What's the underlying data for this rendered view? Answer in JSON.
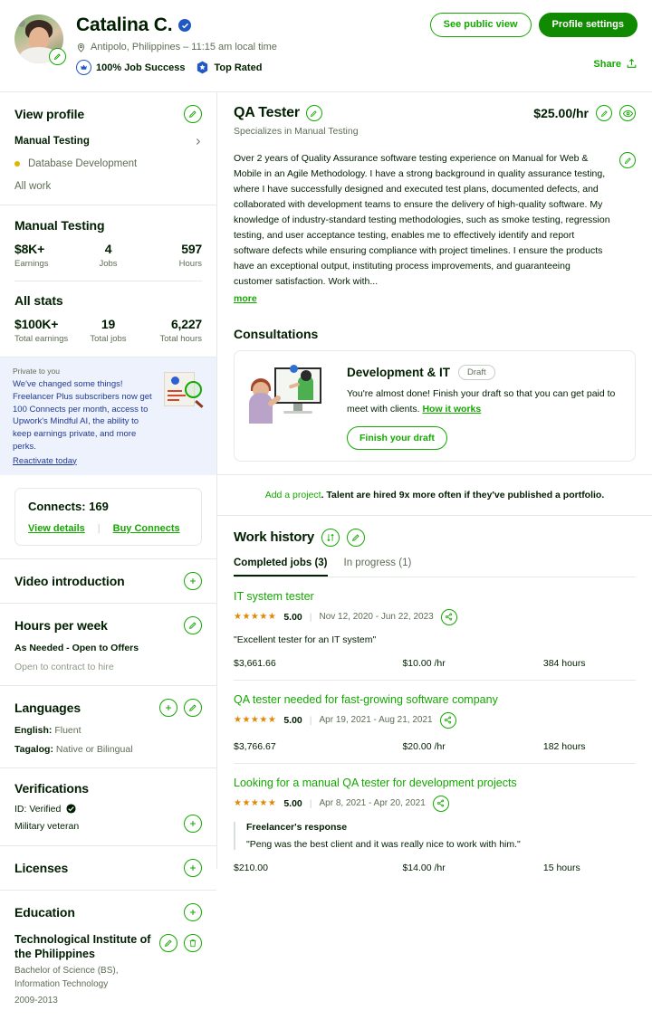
{
  "header": {
    "name": "Catalina C.",
    "verified_icon": "verified-check-icon",
    "location": "Antipolo, Philippines – 11:15 am local time",
    "job_success": "100% Job Success",
    "top_rated": "Top Rated",
    "see_public_view": "See public view",
    "profile_settings": "Profile settings",
    "share": "Share"
  },
  "sidebar": {
    "view_profile": "View profile",
    "nav": {
      "manual_testing": "Manual Testing",
      "database_development": "Database Development",
      "all_work": "All work"
    },
    "specialty_stats": {
      "title": "Manual Testing",
      "items": [
        {
          "value": "$8K+",
          "label": "Earnings"
        },
        {
          "value": "4",
          "label": "Jobs"
        },
        {
          "value": "597",
          "label": "Hours"
        }
      ]
    },
    "all_stats": {
      "title": "All stats",
      "items": [
        {
          "value": "$100K+",
          "label": "Total earnings"
        },
        {
          "value": "19",
          "label": "Total jobs"
        },
        {
          "value": "6,227",
          "label": "Total hours"
        }
      ]
    },
    "promo": {
      "eyebrow": "Private to you",
      "text": "We've changed some things! Freelancer Plus subscribers now get 100 Connects per month, access to Upwork's Mindful AI, the ability to keep earnings private, and more perks.",
      "link": "Reactivate today"
    },
    "connects": {
      "title": "Connects: 169",
      "view_details": "View details",
      "separator": "|",
      "buy_connects": "Buy Connects"
    },
    "video_introduction": "Video introduction",
    "hours_per_week": {
      "title": "Hours per week",
      "value": "As Needed - Open to Offers",
      "note": "Open to contract to hire"
    },
    "languages": {
      "title": "Languages",
      "items": [
        {
          "name": "English",
          "level": "Fluent"
        },
        {
          "name": "Tagalog",
          "level": "Native or Bilingual"
        }
      ]
    },
    "verifications": {
      "title": "Verifications",
      "id_label": "ID: Verified",
      "military": "Military veteran"
    },
    "licenses": {
      "title": "Licenses"
    },
    "education": {
      "title": "Education",
      "school": "Technological Institute of the Philippines",
      "degree": "Bachelor of Science (BS), Information Technology",
      "years": "2009-2013"
    }
  },
  "main": {
    "job_title": "QA Tester",
    "specializes": "Specializes in Manual Testing",
    "rate": "$25.00/hr",
    "description": "Over 2 years of Quality Assurance software testing experience on Manual for Web & Mobile in an Agile Methodology. I have a strong background in quality assurance testing, where I have successfully designed and executed test plans, documented defects, and collaborated with development teams to ensure the delivery of high-quality software. My knowledge of industry-standard testing methodologies, such as smoke testing, regression testing, and user acceptance testing, enables me to effectively identify and report software defects while ensuring compliance with project timelines. I ensure the products have an exceptional output, instituting process improvements, and guaranteeing customer satisfaction. Work with...",
    "more_link": "more",
    "consultations": {
      "title": "Consultations",
      "card_title": "Development & IT",
      "status_pill": "Draft",
      "text": "You're almost done! Finish your draft so that you can get paid to meet with clients.",
      "how_it_works": "How it works",
      "cta": "Finish your draft"
    },
    "add_project": {
      "link": "Add a project",
      "text": ". Talent are hired 9x more often if they've published a portfolio."
    },
    "work_history": {
      "title": "Work history",
      "tabs": [
        {
          "label": "Completed jobs (3)",
          "active": true
        },
        {
          "label": "In progress (1)",
          "active": false
        }
      ],
      "jobs": [
        {
          "title": "IT system tester",
          "stars": "★★★★★",
          "score": "5.00",
          "dates": "Nov 12, 2020 - Jun 22, 2023",
          "feedback": "\"Excellent tester for an IT system\"",
          "earned": "$3,661.66",
          "rate": "$10.00 /hr",
          "hours": "384 hours"
        },
        {
          "title": "QA tester needed for fast-growing software company",
          "stars": "★★★★★",
          "score": "5.00",
          "dates": "Apr 19, 2021 - Aug 21, 2021",
          "feedback": "",
          "earned": "$3,766.67",
          "rate": "$20.00 /hr",
          "hours": "182 hours"
        },
        {
          "title": "Looking for a manual QA tester for development projects",
          "stars": "★★★★★",
          "score": "5.00",
          "dates": "Apr 8, 2021 - Apr 20, 2021",
          "response_label": "Freelancer's response",
          "response_text": "\"Peng was the best client and it was really nice to work with him.\"",
          "earned": "$210.00",
          "rate": "$14.00 /hr",
          "hours": "15 hours"
        }
      ]
    }
  },
  "colors": {
    "brand_green": "#14a800",
    "brand_green_dark": "#108a00",
    "blue": "#1f57c3",
    "star_orange": "#e08800",
    "yellow_dot": "#e0b400"
  }
}
